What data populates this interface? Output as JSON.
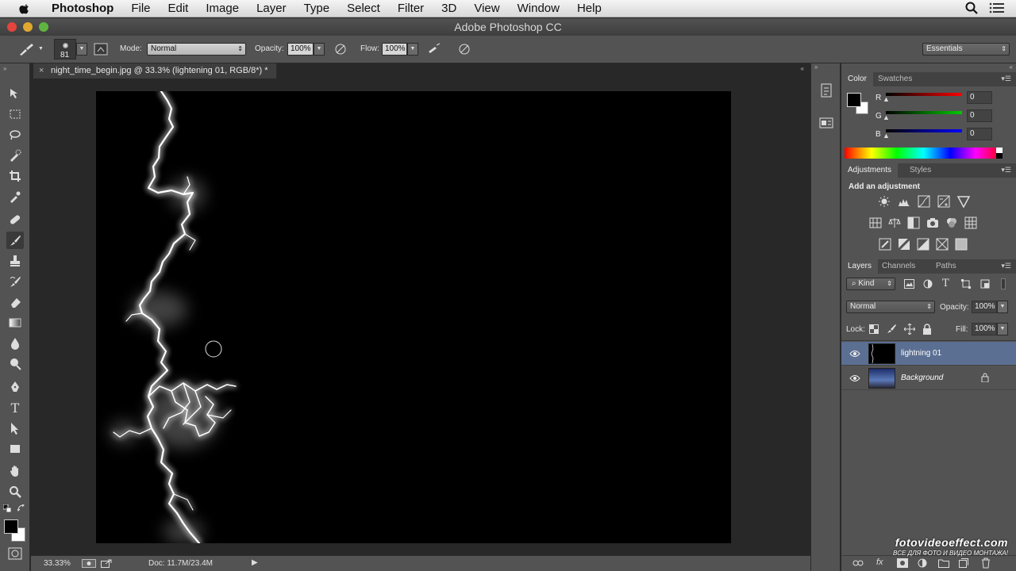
{
  "menubar": {
    "app_name": "Photoshop",
    "items": [
      "File",
      "Edit",
      "Image",
      "Layer",
      "Type",
      "Select",
      "Filter",
      "3D",
      "View",
      "Window",
      "Help"
    ]
  },
  "window": {
    "title": "Adobe Photoshop CC"
  },
  "options": {
    "brush_size": "81",
    "mode_label": "Mode:",
    "mode_value": "Normal",
    "opacity_label": "Opacity:",
    "opacity_value": "100%",
    "flow_label": "Flow:",
    "flow_value": "100%",
    "workspace": "Essentials"
  },
  "document": {
    "tab_title": "night_time_begin.jpg @ 33.3% (lightening 01, RGB/8*) *"
  },
  "statusbar": {
    "zoom": "33.33%",
    "doc_info": "Doc: 11.7M/23.4M"
  },
  "color_panel": {
    "tabs": [
      "Color",
      "Swatches"
    ],
    "channels": [
      {
        "label": "R",
        "value": "0"
      },
      {
        "label": "G",
        "value": "0"
      },
      {
        "label": "B",
        "value": "0"
      }
    ]
  },
  "adjustments_panel": {
    "tabs": [
      "Adjustments",
      "Styles"
    ],
    "heading": "Add an adjustment"
  },
  "layers_panel": {
    "tabs": [
      "Layers",
      "Channels",
      "Paths"
    ],
    "filter_kind": "Kind",
    "blend_mode": "Normal",
    "opacity_label": "Opacity:",
    "opacity_value": "100%",
    "lock_label": "Lock:",
    "fill_label": "Fill:",
    "fill_value": "100%",
    "layers": [
      {
        "name": "lightning 01",
        "selected": true
      },
      {
        "name": "Background",
        "selected": false
      }
    ]
  },
  "watermark": {
    "line1": "fotovideoeffect.com",
    "line2": "ВСЕ ДЛЯ ФОТО И ВИДЕО МОНТАЖА!"
  },
  "colors": {
    "selected_layer": "#5b6f93",
    "panel_bg": "#535353",
    "canvas_bg": "#000000"
  }
}
